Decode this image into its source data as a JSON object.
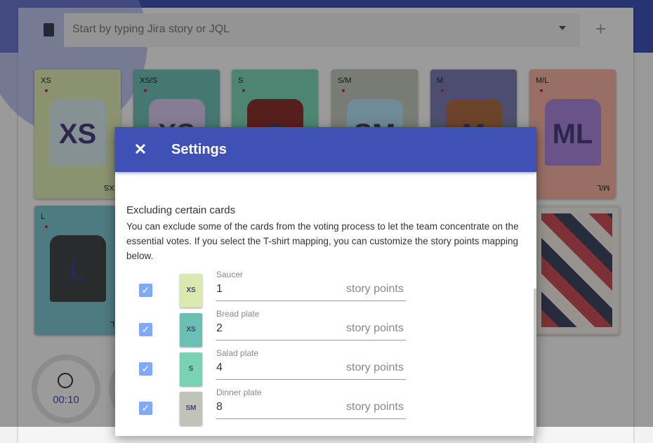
{
  "search": {
    "placeholder": "Start by typing Jira story or JQL",
    "add_icon": "+"
  },
  "cards": [
    {
      "label": "XS",
      "art": "XS",
      "color": "#dbe8b0",
      "shirt": "#d4e6f0"
    },
    {
      "label": "XS/S",
      "art": "XS",
      "color": "#6cbfb3",
      "shirt": "#e0c4f0"
    },
    {
      "label": "S",
      "art": "S",
      "color": "#7ad2b5",
      "shirt": "#8b2020"
    },
    {
      "label": "S/M",
      "art": "SM",
      "color": "#c0c4b8",
      "shirt": "#aee0f5"
    },
    {
      "label": "M",
      "art": "M",
      "color": "#7b7bb0",
      "shirt": "#b06a3a"
    },
    {
      "label": "M/L",
      "art": "ML",
      "color": "#f2b0a0",
      "shirt": "#a080e0"
    },
    {
      "label": "L",
      "art": "L",
      "color": "#7cc3cc",
      "shirt": "#3a3a3a"
    }
  ],
  "timer": {
    "value": "00:10"
  },
  "dialog": {
    "title": "Settings",
    "close_icon": "✕",
    "section_title": "Excluding certain cards",
    "section_text": "You can exclude some of the cards from the voting process to let the team concentrate on the essential votes. If you select the T-shirt mapping, you can customize the story points mapping below.",
    "unit": "story points",
    "rows": [
      {
        "label": "Saucer",
        "value": "1",
        "card": "XS",
        "color": "#dbe8b0",
        "checked": true
      },
      {
        "label": "Bread plate",
        "value": "2",
        "card": "XS",
        "color": "#6cbfb3",
        "checked": true
      },
      {
        "label": "Salad plate",
        "value": "4",
        "card": "S",
        "color": "#7ad2b5",
        "checked": true
      },
      {
        "label": "Dinner plate",
        "value": "8",
        "card": "SM",
        "color": "#c0c4b8",
        "checked": true
      }
    ]
  }
}
